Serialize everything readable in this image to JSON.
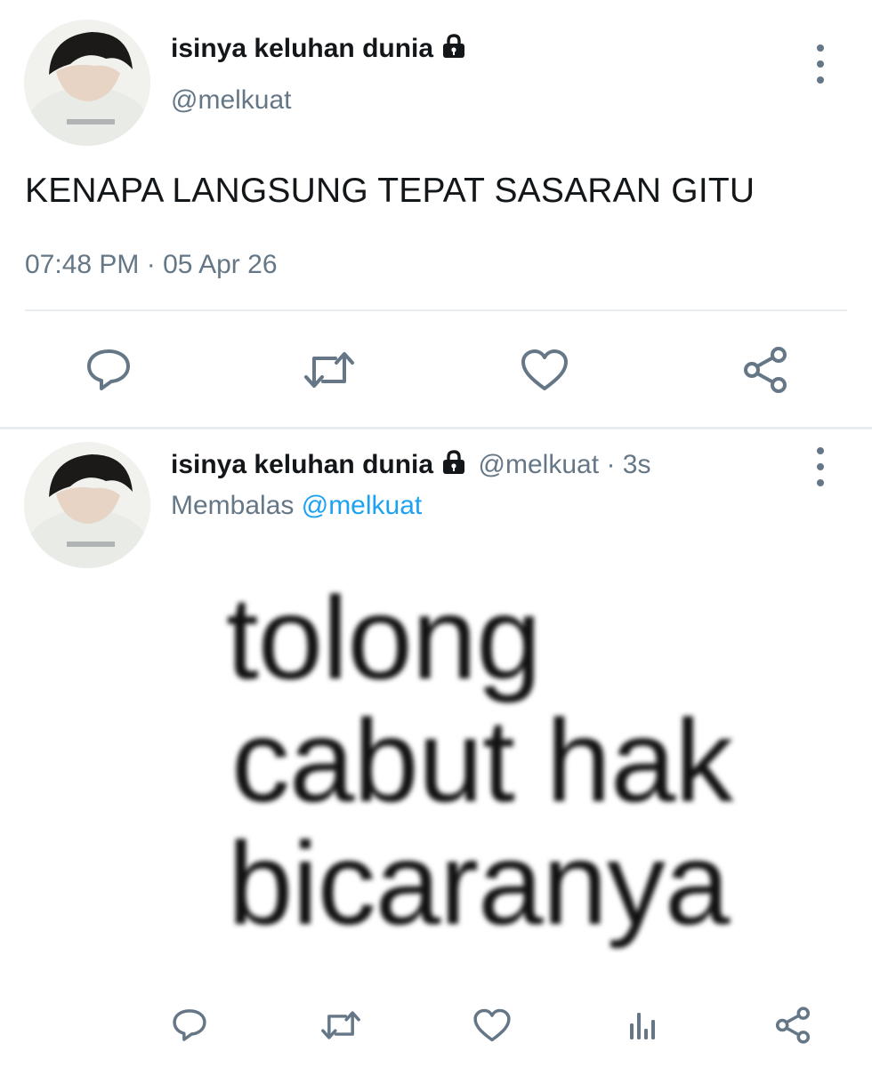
{
  "main_tweet": {
    "display_name": "isinya keluhan dunia",
    "handle": "@melkuat",
    "text": "KENAPA LANGSUNG TEPAT SASARAN GITU",
    "timestamp": "07:48 PM · 05 Apr 26",
    "actions": [
      "reply-icon",
      "retweet-icon",
      "like-icon",
      "share-icon"
    ]
  },
  "reply_tweet": {
    "display_name": "isinya keluhan dunia",
    "handle": "@melkuat",
    "time_ago": "· 3s",
    "replying_prefix": "Membalas",
    "replying_to": "@melkuat",
    "image_text_lines": [
      "tolong",
      "cabut hak",
      "bicaranya"
    ],
    "actions": [
      "reply-icon",
      "retweet-icon",
      "like-icon",
      "analytics-icon",
      "share-icon"
    ]
  },
  "colors": {
    "text_primary": "#14171a",
    "text_secondary": "#657786",
    "link": "#1da1f2",
    "divider": "#e6ecf0"
  }
}
